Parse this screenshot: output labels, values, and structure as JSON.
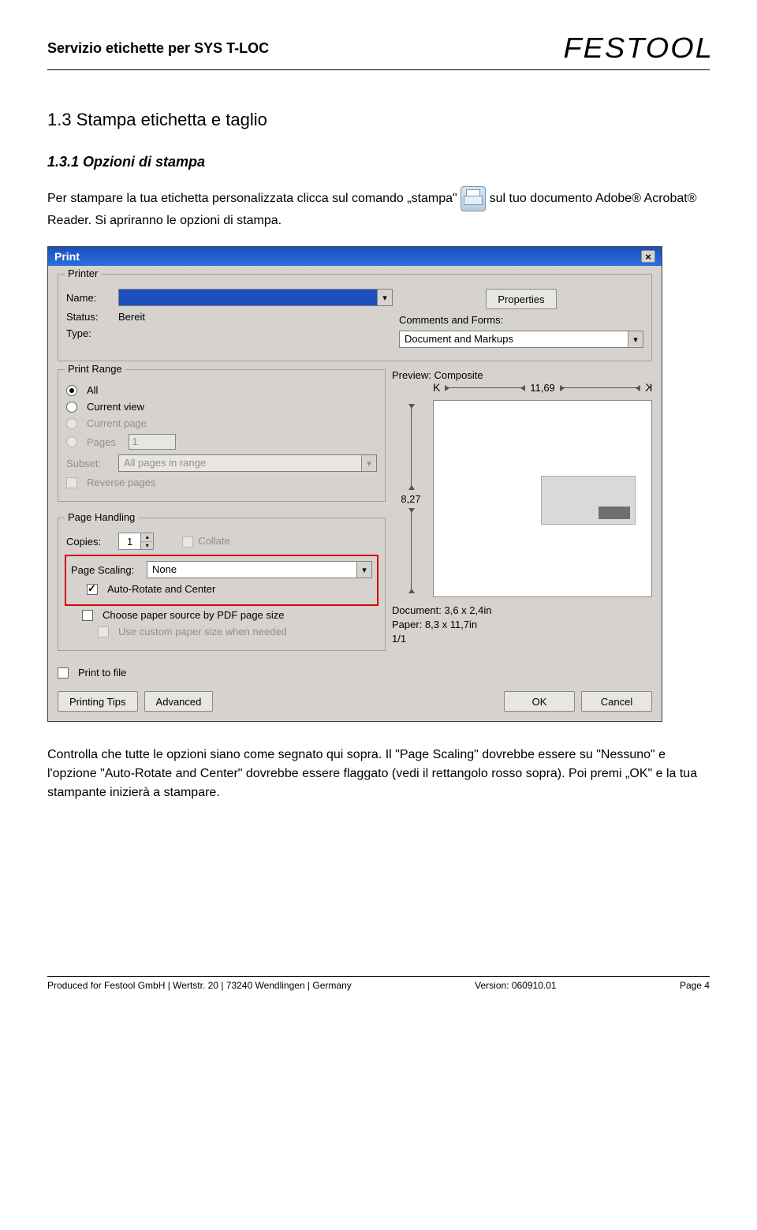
{
  "header": {
    "title": "Servizio etichette per SYS T-LOC",
    "brand": "FESTOOL"
  },
  "section": {
    "title": "1.3 Stampa etichetta e taglio",
    "subtitle": "1.3.1 Opzioni di stampa"
  },
  "para1": {
    "pre": "Per stampare la tua etichetta personalizzata clicca sul comando „stampa\"",
    "post": "sul tuo documento Adobe® Acrobat® Reader. Si apriranno le opzioni di stampa."
  },
  "dialog": {
    "title": "Print",
    "printer_section": "Printer",
    "name_lbl": "Name:",
    "status_lbl": "Status:",
    "status_val": "Bereit",
    "type_lbl": "Type:",
    "properties_btn": "Properties",
    "comments_lbl": "Comments and Forms:",
    "comments_val": "Document and Markups",
    "range_section": "Print Range",
    "range": {
      "all": "All",
      "current_view": "Current view",
      "current_page": "Current page",
      "pages": "Pages",
      "pages_val": "1",
      "subset_lbl": "Subset:",
      "subset_val": "All pages in range",
      "reverse": "Reverse pages"
    },
    "handling_section": "Page Handling",
    "copies_lbl": "Copies:",
    "copies_val": "1",
    "collate": "Collate",
    "scaling_lbl": "Page Scaling:",
    "scaling_val": "None",
    "autorotate": "Auto-Rotate and Center",
    "choose_source": "Choose paper source by PDF page size",
    "custom_paper": "Use custom paper size when needed",
    "print_to_file": "Print to file",
    "preview_lbl": "Preview: Composite",
    "dim_w": "11,69",
    "dim_h": "8,27",
    "doc_info": "Document: 3,6 x 2,4in",
    "paper_info": "Paper: 8,3 x 11,7in",
    "page_of": "1/1",
    "printing_tips": "Printing Tips",
    "advanced": "Advanced",
    "ok": "OK",
    "cancel": "Cancel"
  },
  "para2": "Controlla che tutte le opzioni siano come segnato qui sopra. Il \"Page Scaling\" dovrebbe essere su \"Nessuno\" e l'opzione \"Auto-Rotate and Center\" dovrebbe essere flaggato (vedi il rettangolo rosso sopra). Poi premi „OK\" e la tua stampante inizierà a stampare.",
  "footer": {
    "left": "Produced for Festool GmbH | Wertstr. 20 | 73240 Wendlingen | Germany",
    "mid": "Version: 060910.01",
    "right": "Page 4"
  }
}
